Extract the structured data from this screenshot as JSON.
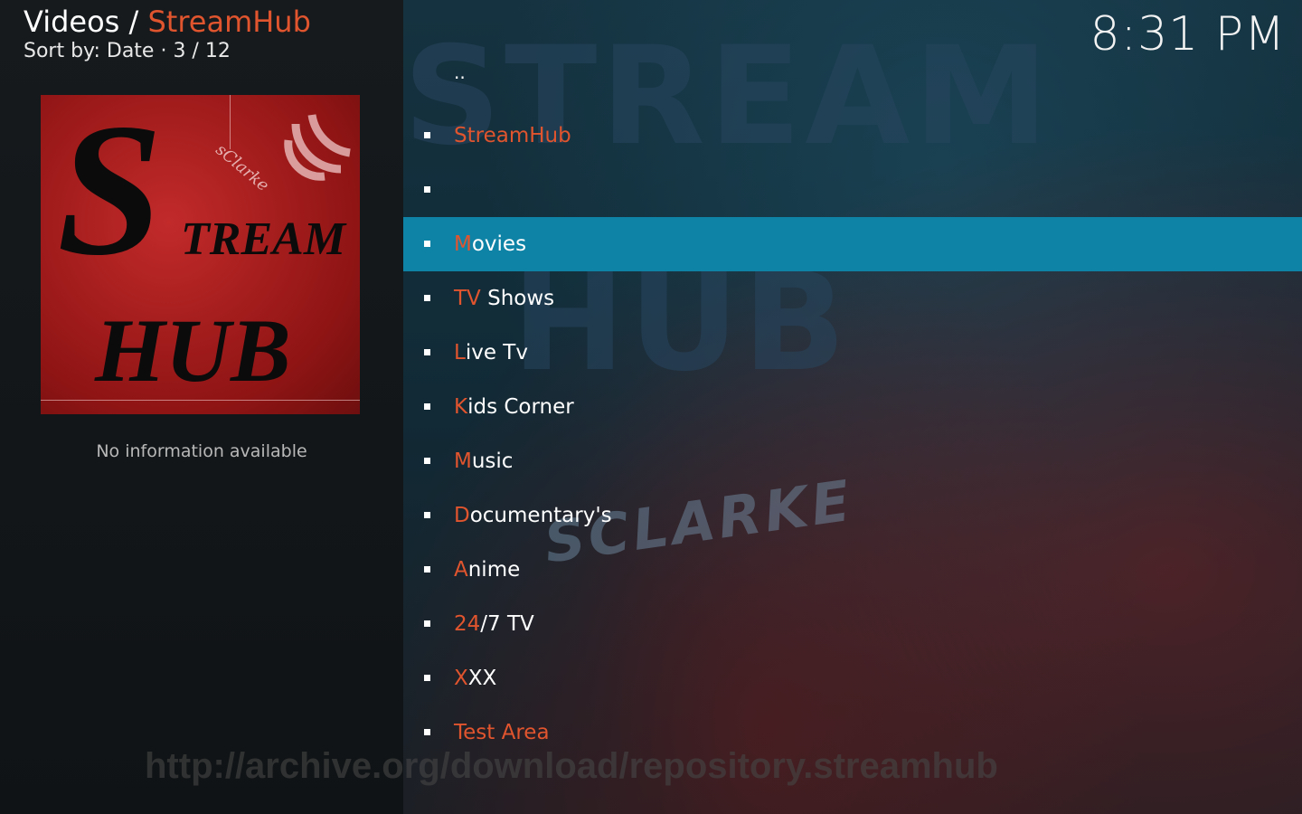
{
  "header": {
    "section": "Videos",
    "separator": " / ",
    "addon": "StreamHub",
    "sort_text": "Sort by: Date  ·  3 / 12"
  },
  "clock": "8:31 PM",
  "thumbnail": {
    "big_letter": "S",
    "tream": "TREAM",
    "hub": "HUB",
    "signature": "sClarke"
  },
  "info": "No information available",
  "list": {
    "updir": "..",
    "items": [
      {
        "first": "StreamHub",
        "rest": "",
        "all_orange": true
      },
      {
        "first": "",
        "rest": "",
        "all_orange": false
      },
      {
        "first": "M",
        "rest": "ovies",
        "all_orange": false,
        "selected": true
      },
      {
        "first": "TV",
        "rest": " Shows",
        "all_orange": false
      },
      {
        "first": "L",
        "rest": "ive Tv",
        "all_orange": false
      },
      {
        "first": "K",
        "rest": "ids Corner",
        "all_orange": false
      },
      {
        "first": "M",
        "rest": "usic",
        "all_orange": false
      },
      {
        "first": "D",
        "rest": "ocumentary's",
        "all_orange": false
      },
      {
        "first": "A",
        "rest": "nime",
        "all_orange": false
      },
      {
        "first": "24",
        "rest": "/7 TV",
        "all_orange": false
      },
      {
        "first": "X",
        "rest": "XX",
        "all_orange": false
      },
      {
        "first": "Test Area",
        "rest": "",
        "all_orange": true
      }
    ]
  },
  "watermarks": {
    "stream": "STREAM",
    "hub": "HUB",
    "sclarke": "SCLARKE",
    "url": "http://archive.org/download/repository.streamhub"
  },
  "colors": {
    "accent": "#e0542e",
    "selection": "#0f83a6"
  }
}
